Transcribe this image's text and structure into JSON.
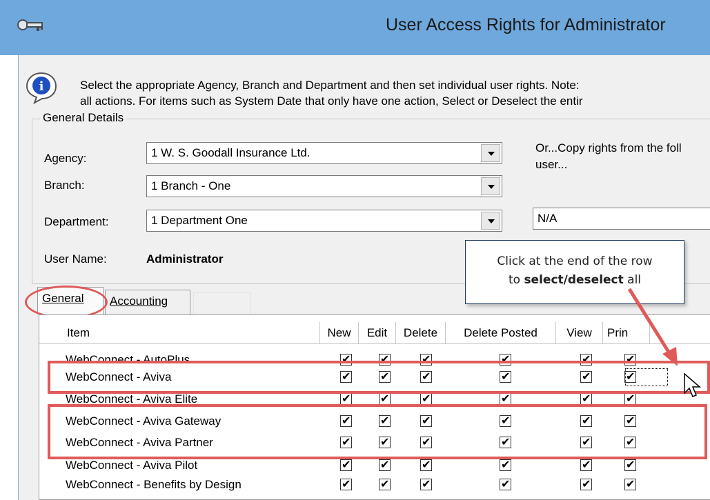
{
  "window": {
    "title": "User Access Rights for Administrator"
  },
  "info": {
    "line1": "Select the appropriate Agency, Branch and Department and then set individual user rights.  Note:",
    "line2": "all actions.  For items such as System Date that only have one action, Select or Deselect the entir"
  },
  "general_details": {
    "legend": "General Details",
    "agency_label": "Agency:",
    "agency_value": "1 W. S. Goodall Insurance Ltd.",
    "branch_label": "Branch:",
    "branch_value": "1 Branch - One",
    "department_label": "Department:",
    "department_value": "1 Department One",
    "username_label": "User Name:",
    "username_value": "Administrator",
    "copy_label_line1": "Or...Copy rights from the foll",
    "copy_label_line2": "user...",
    "copy_value": "N/A"
  },
  "tabs": [
    {
      "label": "General",
      "active": true
    },
    {
      "label": "Accounting",
      "active": false
    }
  ],
  "grid": {
    "headers": [
      "Item",
      "New",
      "Edit",
      "Delete",
      "Delete Posted",
      "View",
      "Prin"
    ],
    "rows": [
      {
        "item": "WebConnect - AutoPlus",
        "checks": [
          true,
          true,
          true,
          true,
          true,
          true
        ]
      },
      {
        "item": "WebConnect - Aviva",
        "checks": [
          true,
          true,
          true,
          true,
          true,
          true
        ]
      },
      {
        "item": "WebConnect - Aviva Elite",
        "checks": [
          true,
          true,
          true,
          true,
          true,
          true
        ]
      },
      {
        "item": "WebConnect - Aviva Gateway",
        "checks": [
          true,
          true,
          true,
          true,
          true,
          true
        ]
      },
      {
        "item": "WebConnect - Aviva Partner",
        "checks": [
          true,
          true,
          true,
          true,
          true,
          true
        ]
      },
      {
        "item": "WebConnect - Aviva Pilot",
        "checks": [
          true,
          true,
          true,
          true,
          true,
          true
        ]
      },
      {
        "item": "WebConnect - Benefits by Design",
        "checks": [
          true,
          true,
          true,
          true,
          true,
          true
        ]
      }
    ]
  },
  "callout": {
    "line1": "Click at the end of the row",
    "line2_prefix": "to ",
    "line2_bold": "select/deselect",
    "line2_suffix": " all"
  },
  "colors": {
    "titlebar": "#6fa8dc",
    "annotation_red": "#e05a5a",
    "callout_border": "#1f3a66"
  },
  "icons": [
    "key-icon",
    "info-icon",
    "dropdown-arrow-icon",
    "checkbox-icon",
    "mouse-pointer-icon",
    "annotation-arrow-icon"
  ]
}
